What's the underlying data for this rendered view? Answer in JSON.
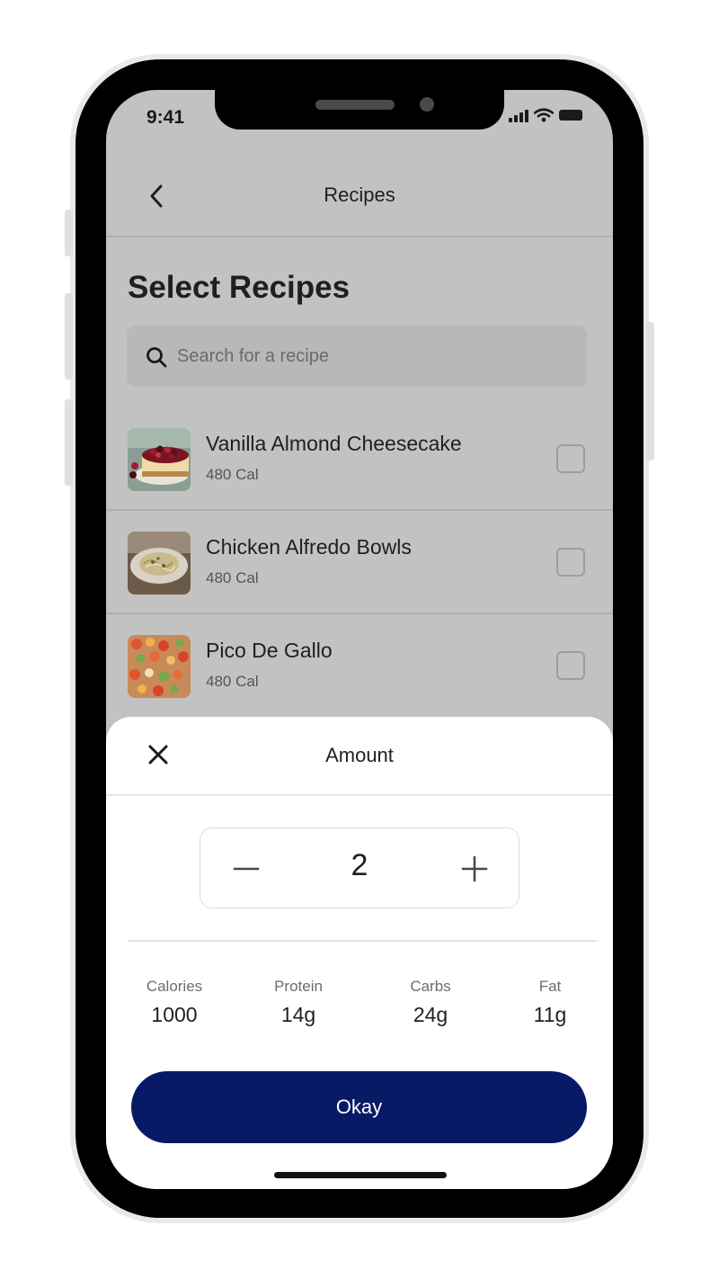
{
  "status_bar": {
    "time": "9:41"
  },
  "nav": {
    "title": "Recipes"
  },
  "page": {
    "title": "Select Recipes"
  },
  "search": {
    "placeholder": "Search for a recipe"
  },
  "recipes": [
    {
      "name": "Vanilla Almond Cheesecake",
      "calories": "480 Cal",
      "checked": false
    },
    {
      "name": "Chicken Alfredo Bowls",
      "calories": "480 Cal",
      "checked": false
    },
    {
      "name": "Pico De Gallo",
      "calories": "480 Cal",
      "checked": false
    }
  ],
  "sheet": {
    "title": "Amount",
    "amount": "2",
    "macros": [
      {
        "label": "Calories",
        "value": "1000"
      },
      {
        "label": "Protein",
        "value": "14g"
      },
      {
        "label": "Carbs",
        "value": "24g"
      },
      {
        "label": "Fat",
        "value": "11g"
      }
    ],
    "okay_label": "Okay"
  },
  "colors": {
    "primary": "#081a66",
    "overlay": "#c2c2c2"
  }
}
